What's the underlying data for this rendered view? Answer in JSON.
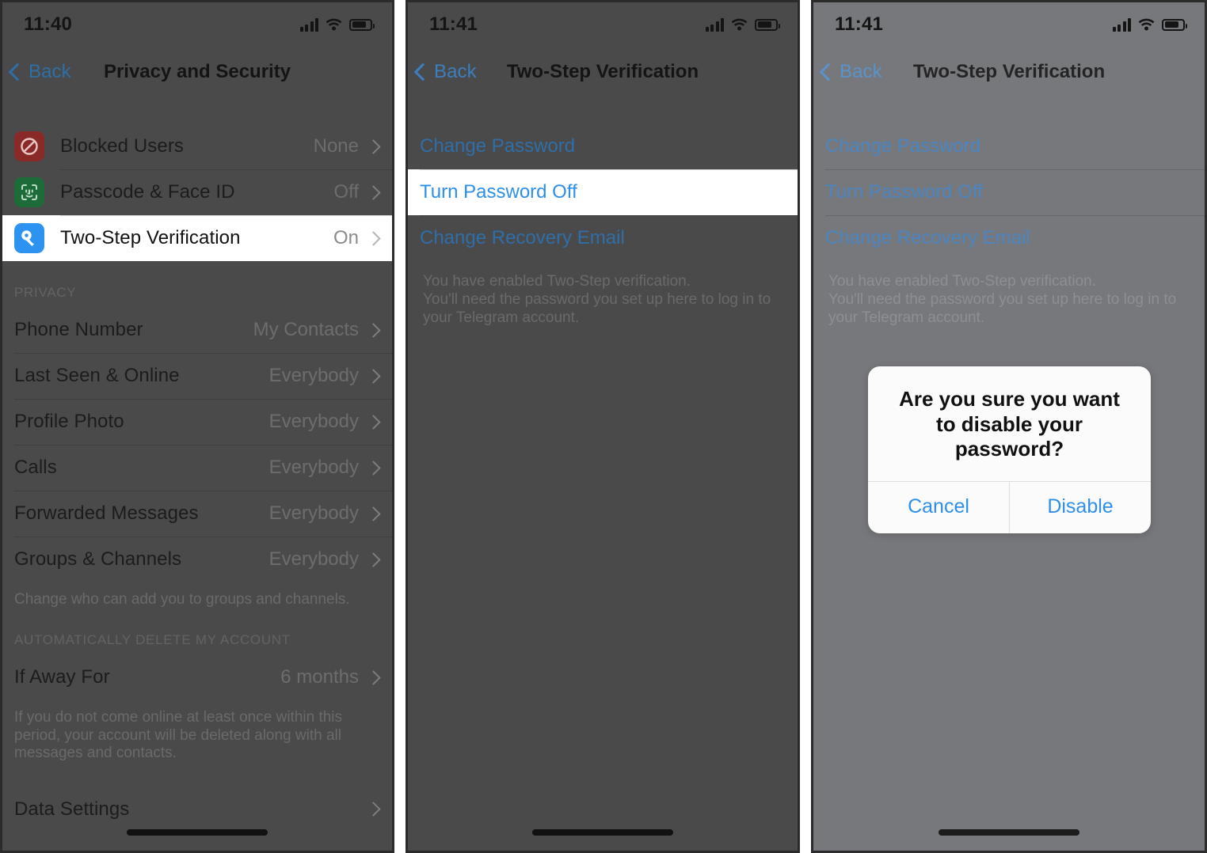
{
  "panels": [
    {
      "id": "privacy-and-security",
      "status": {
        "time": "11:40",
        "signal_icon": "cellular-signal-icon",
        "wifi_icon": "wifi-icon",
        "battery_icon": "battery-icon"
      },
      "nav": {
        "back_label": "Back",
        "title": "Privacy and Security",
        "back_icon": "chevron-left-icon"
      },
      "security_rows": [
        {
          "icon": "blocked-users-icon",
          "label": "Blocked Users",
          "value": "None"
        },
        {
          "icon": "face-id-icon",
          "label": "Passcode & Face ID",
          "value": "Off"
        },
        {
          "icon": "key-icon",
          "label": "Two-Step Verification",
          "value": "On"
        }
      ],
      "privacy_header": "PRIVACY",
      "privacy_rows": [
        {
          "label": "Phone Number",
          "value": "My Contacts"
        },
        {
          "label": "Last Seen & Online",
          "value": "Everybody"
        },
        {
          "label": "Profile Photo",
          "value": "Everybody"
        },
        {
          "label": "Calls",
          "value": "Everybody"
        },
        {
          "label": "Forwarded Messages",
          "value": "Everybody"
        },
        {
          "label": "Groups & Channels",
          "value": "Everybody"
        }
      ],
      "privacy_footer": "Change who can add you to groups and channels.",
      "delete_header": "AUTOMATICALLY DELETE MY ACCOUNT",
      "delete_rows": [
        {
          "label": "If Away For",
          "value": "6 months"
        }
      ],
      "delete_footer": "If you do not come online at least once within this period, your account will be deleted along with all messages and contacts.",
      "last_rows": [
        {
          "label": "Data Settings",
          "value": ""
        }
      ]
    },
    {
      "id": "two-step-verification-highlighted",
      "status": {
        "time": "11:41",
        "signal_icon": "cellular-signal-icon",
        "wifi_icon": "wifi-icon",
        "battery_icon": "battery-icon"
      },
      "nav": {
        "back_label": "Back",
        "title": "Two-Step Verification",
        "back_icon": "chevron-left-icon"
      },
      "links": [
        {
          "label": "Change Password"
        },
        {
          "label": "Turn Password Off"
        },
        {
          "label": "Change Recovery Email"
        }
      ],
      "note": "You have enabled Two-Step verification.\nYou'll need the password you set up here to log in to your Telegram account."
    },
    {
      "id": "two-step-verification-alert",
      "status": {
        "time": "11:41",
        "signal_icon": "cellular-signal-icon",
        "wifi_icon": "wifi-icon",
        "battery_icon": "battery-icon"
      },
      "nav": {
        "back_label": "Back",
        "title": "Two-Step Verification",
        "back_icon": "chevron-left-icon"
      },
      "links": [
        {
          "label": "Change Password"
        },
        {
          "label": "Turn Password Off"
        },
        {
          "label": "Change Recovery Email"
        }
      ],
      "note": "You have enabled Two-Step verification.\nYou'll need the password you set up here to log in to your Telegram account.",
      "alert": {
        "title": "Are you sure you want to disable your password?",
        "cancel_label": "Cancel",
        "confirm_label": "Disable"
      }
    }
  ],
  "colors": {
    "accent_blue": "#2d8fe8",
    "link_blue_dim": "#2f6ea8",
    "blocked_red": "#8a2a28",
    "faceid_green": "#1d6b38",
    "key_blue": "#2d93f0",
    "dim_dark": "#4a4a4a",
    "dim_medium": "#77787c"
  }
}
